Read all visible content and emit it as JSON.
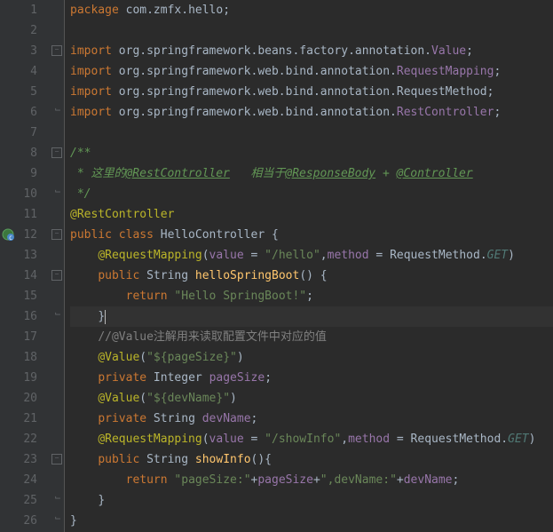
{
  "lines": [
    {
      "n": 1,
      "fold": "",
      "html": "<span class='kw'>package</span> <span class='pkg'>com.zmfx.hello</span><span class='op'>;</span>"
    },
    {
      "n": 2,
      "fold": "",
      "html": ""
    },
    {
      "n": 3,
      "fold": "minus",
      "html": "<span class='kw'>import</span> <span class='pkg'>org.springframework.beans.factory.annotation.</span><span class='fld'>Value</span><span class='op'>;</span>"
    },
    {
      "n": 4,
      "fold": "",
      "html": "<span class='kw'>import</span> <span class='pkg'>org.springframework.web.bind.annotation.</span><span class='fld'>RequestMapping</span><span class='op'>;</span>"
    },
    {
      "n": 5,
      "fold": "",
      "html": "<span class='kw'>import</span> <span class='pkg'>org.springframework.web.bind.annotation.RequestMethod</span><span class='op'>;</span>"
    },
    {
      "n": 6,
      "fold": "end",
      "html": "<span class='kw'>import</span> <span class='pkg'>org.springframework.web.bind.annotation.</span><span class='fld'>RestController</span><span class='op'>;</span>"
    },
    {
      "n": 7,
      "fold": "",
      "html": ""
    },
    {
      "n": 8,
      "fold": "minus",
      "html": "<span class='docc'>/**</span>"
    },
    {
      "n": 9,
      "fold": "",
      "html": "<span class='docc'> * 这里的</span><span class='doct'>@RestController</span><span class='docc'>   相当于</span><span class='doct'>@ResponseBody</span><span class='docc'> + </span><span class='doct'>@Controller</span>"
    },
    {
      "n": 10,
      "fold": "end",
      "html": "<span class='docc'> */</span>"
    },
    {
      "n": 11,
      "fold": "",
      "html": "<span class='ann'>@RestController</span>"
    },
    {
      "n": 12,
      "fold": "minus",
      "icon": "run",
      "html": "<span class='kw'>public class</span> <span class='cls'>HelloController</span> <span class='op'>{</span>"
    },
    {
      "n": 13,
      "fold": "",
      "html": "    <span class='ann'>@RequestMapping</span><span class='op'>(</span><span class='fld'>value</span> <span class='op'>=</span> <span class='str'>\"/hello\"</span><span class='op'>,</span><span class='fld'>method</span> <span class='op'>=</span> RequestMethod.<span class='fld pitalic'>GET</span><span class='op'>)</span>"
    },
    {
      "n": 14,
      "fold": "minus",
      "html": "    <span class='kw'>public</span> String <span class='mth'>helloSpringBoot</span><span class='op'>() {</span>"
    },
    {
      "n": 15,
      "fold": "",
      "html": "        <span class='kw'>return</span> <span class='str'>\"Hello SpringBoot!\"</span><span class='op'>;</span>"
    },
    {
      "n": 16,
      "fold": "end",
      "current": true,
      "html": "    <span class='op'>}</span><span class='caret'></span>"
    },
    {
      "n": 17,
      "fold": "",
      "html": "    <span class='cmt'>//@Value注解用来读取配置文件中对应的值</span>"
    },
    {
      "n": 18,
      "fold": "",
      "html": "    <span class='ann'>@Value</span><span class='op'>(</span><span class='str'>\"${pageSize}\"</span><span class='op'>)</span>"
    },
    {
      "n": 19,
      "fold": "",
      "html": "    <span class='kw'>private</span> Integer <span class='fld'>pageSize</span><span class='op'>;</span>"
    },
    {
      "n": 20,
      "fold": "",
      "html": "    <span class='ann'>@Value</span><span class='op'>(</span><span class='str'>\"${devName}\"</span><span class='op'>)</span>"
    },
    {
      "n": 21,
      "fold": "",
      "html": "    <span class='kw'>private</span> String <span class='fld'>devName</span><span class='op'>;</span>"
    },
    {
      "n": 22,
      "fold": "",
      "html": "    <span class='ann'>@RequestMapping</span><span class='op'>(</span><span class='fld'>value</span> <span class='op'>=</span> <span class='str'>\"/showInfo\"</span><span class='op'>,</span><span class='fld'>method</span> <span class='op'>=</span> RequestMethod.<span class='fld pitalic'>GET</span><span class='op'>)</span>"
    },
    {
      "n": 23,
      "fold": "minus",
      "html": "    <span class='kw'>public</span> String <span class='mth'>showInfo</span><span class='op'>(){</span>"
    },
    {
      "n": 24,
      "fold": "",
      "html": "        <span class='kw'>return</span> <span class='str'>\"pageSize:\"</span><span class='op'>+</span><span class='fld'>pageSize</span><span class='op'>+</span><span class='str'>\",devName:\"</span><span class='op'>+</span><span class='fld'>devName</span><span class='op'>;</span>"
    },
    {
      "n": 25,
      "fold": "end",
      "html": "    <span class='op'>}</span>"
    },
    {
      "n": 26,
      "fold": "end",
      "html": "<span class='op'>}</span>"
    }
  ],
  "glyphs": {
    "fold_minus": "−",
    "fold_end": "┘"
  }
}
